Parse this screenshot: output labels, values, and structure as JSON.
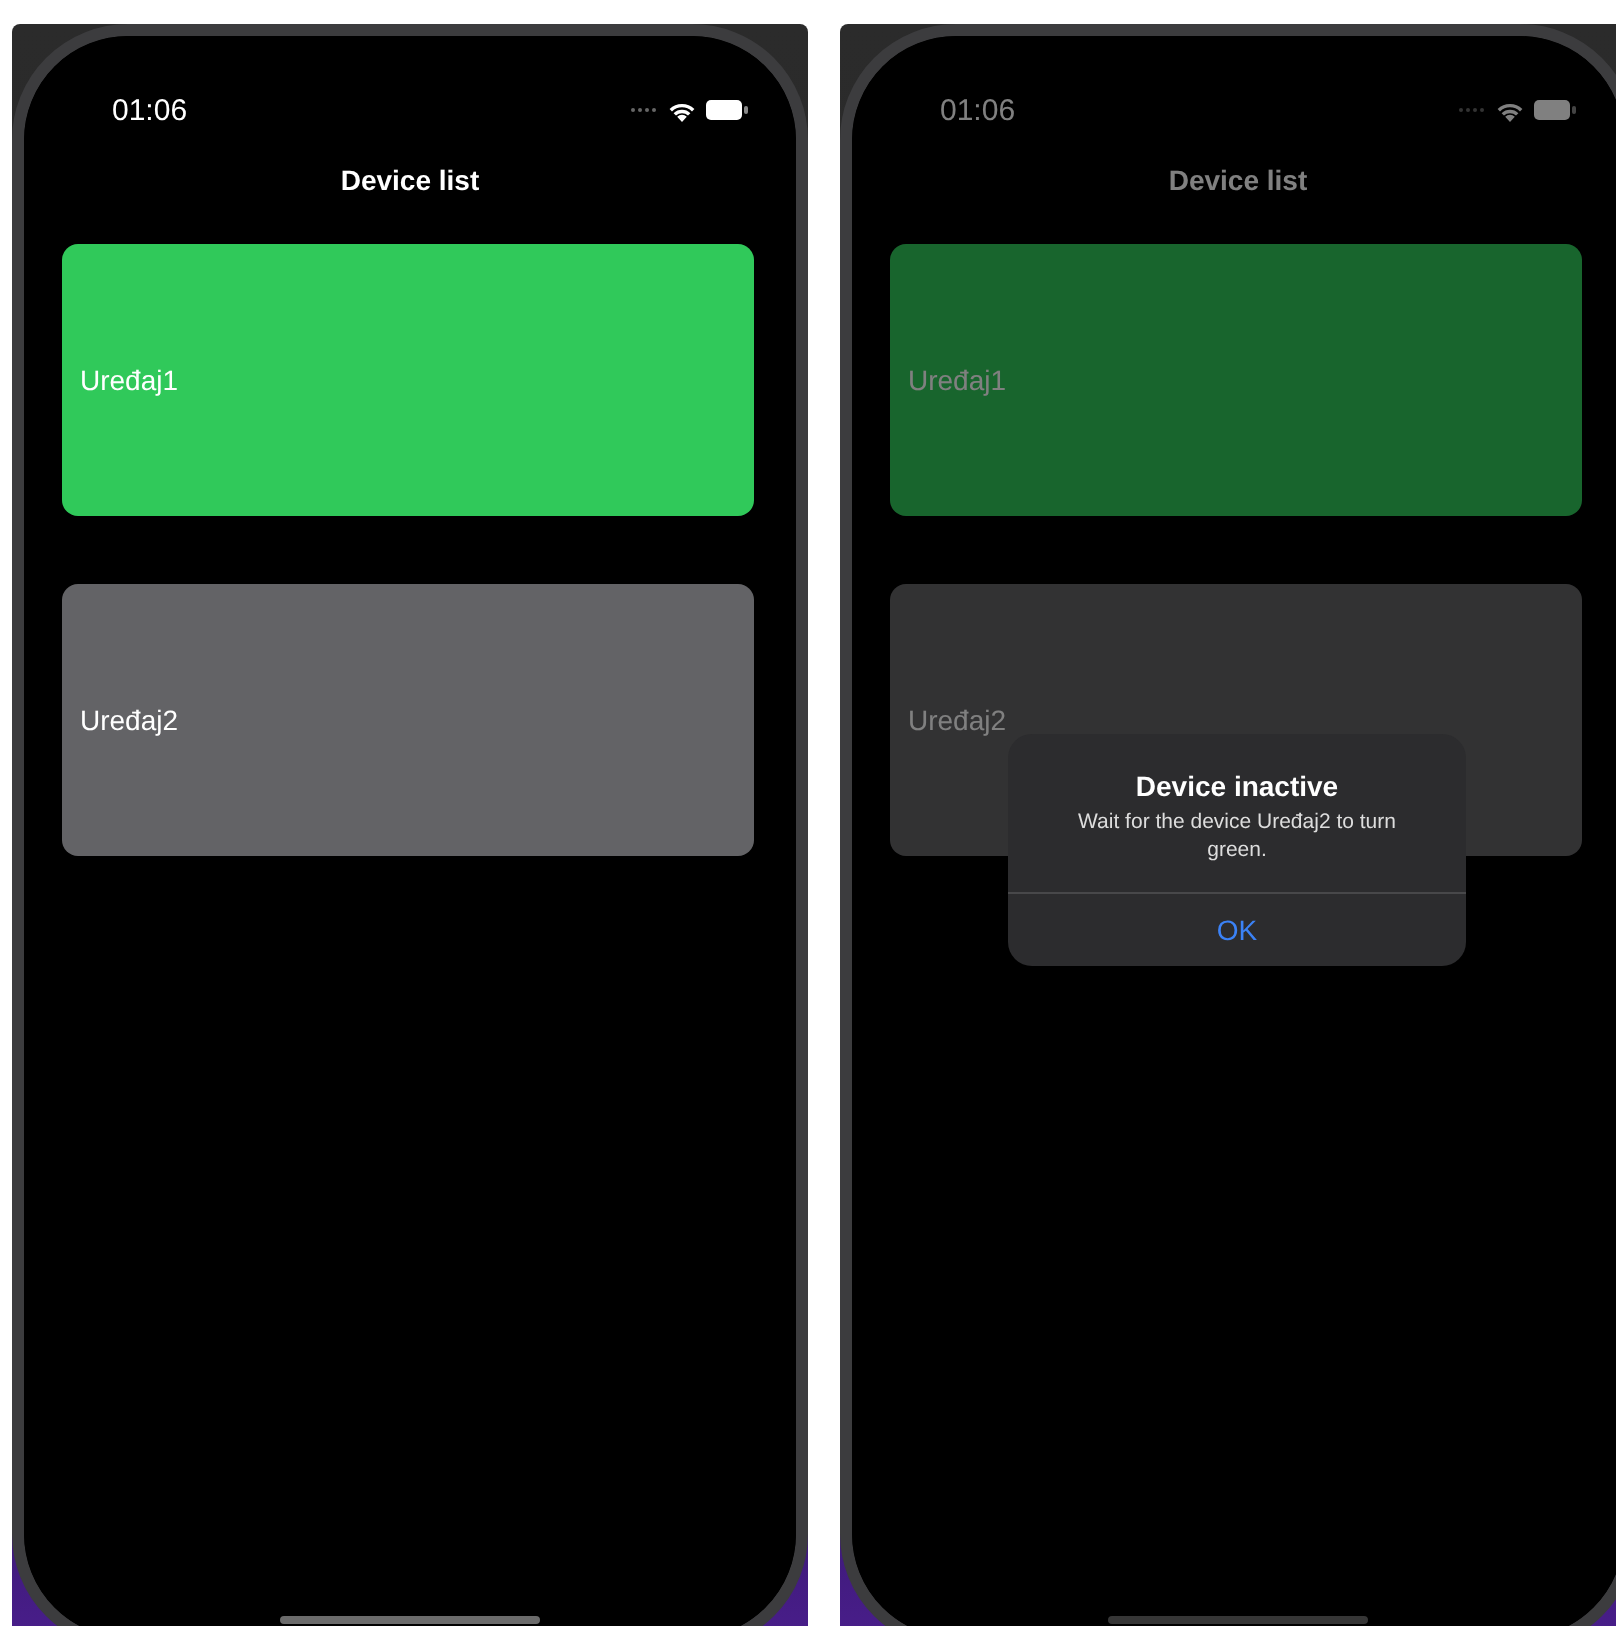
{
  "phones": [
    {
      "status_bar": {
        "time": "01:06"
      },
      "title": "Device list",
      "dimmed": false,
      "devices": [
        {
          "name": "Uređaj1",
          "active": true
        },
        {
          "name": "Uređaj2",
          "active": false
        }
      ]
    },
    {
      "status_bar": {
        "time": "01:06"
      },
      "title": "Device list",
      "dimmed": true,
      "devices": [
        {
          "name": "Uređaj1",
          "active": true
        },
        {
          "name": "Uređaj2",
          "active": false
        }
      ],
      "alert": {
        "title": "Device inactive",
        "message": "Wait for the device Uređaj2 to turn green.",
        "buttons": [
          "OK"
        ]
      }
    }
  ]
}
